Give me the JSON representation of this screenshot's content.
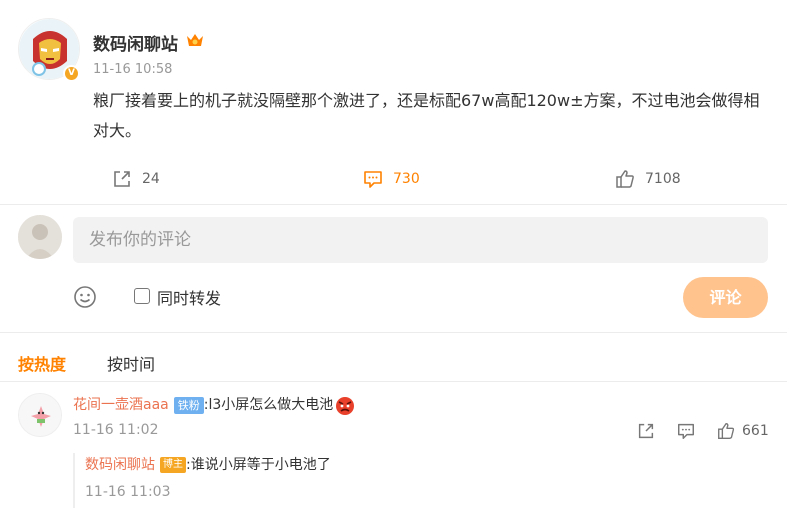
{
  "post": {
    "author": "数码闲聊站",
    "time": "11-16 10:58",
    "text": "粮厂接着要上的机子就没隔壁那个激进了，还是标配67w高配120w±方案，不过电池会做得相对大。",
    "avatar_icon": "iron-man-avatar",
    "vip_icon": "vip-crown-icon",
    "verified_badge": "V",
    "actions": {
      "share_count": "24",
      "comment_count": "730",
      "like_count": "7108"
    }
  },
  "composer": {
    "placeholder": "发布你的评论",
    "repost_label": "同时转发",
    "submit_label": "评论",
    "emoji_icon": "smiley-icon"
  },
  "sort_tabs": {
    "hot": "按热度",
    "time": "按时间"
  },
  "comments": [
    {
      "user": "花间一壶酒aaa",
      "badge": "铁粉",
      "text": ":l3小屏怎么做大电池",
      "emoji": "angry-face-emoji",
      "time": "11-16 11:02",
      "like_count": "661",
      "reply": {
        "user": "数码闲聊站",
        "badge": "博主",
        "text": ":谁说小屏等于小电池了",
        "time": "11-16 11:03"
      }
    }
  ],
  "colors": {
    "accent": "#ff8200",
    "username": "#eb7350",
    "submit_disabled": "#ffc38e",
    "fan_badge": "#6fb1f0",
    "owner_badge": "#f5a623"
  }
}
